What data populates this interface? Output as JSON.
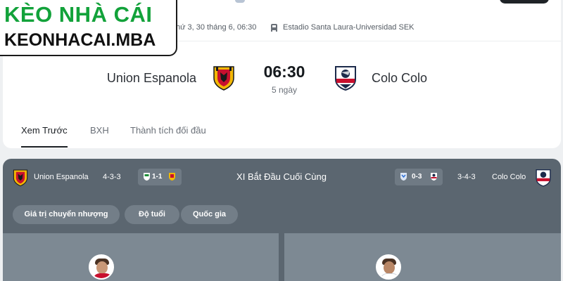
{
  "logo": {
    "line1": "KÈO NHÀ CÁI",
    "line2": "KEONHACAI.MBA"
  },
  "match": {
    "date_text": "hứ 3, 30 tháng 6, 06:30",
    "venue": "Estadio Santa Laura-Universidad SEK",
    "home_team": "Union Espanola",
    "away_team": "Colo Colo",
    "kickoff": "06:30",
    "countdown": "5 ngày"
  },
  "tabs": [
    {
      "label": "Xem Trước",
      "active": true
    },
    {
      "label": "BXH",
      "active": false
    },
    {
      "label": "Thành tích đối đầu",
      "active": false
    }
  ],
  "lineup": {
    "title": "XI Bắt Đầu Cuối Cùng",
    "home_team": "Union Espanola",
    "home_formation": "4-3-3",
    "home_last_score": "1-1",
    "away_team": "Colo Colo",
    "away_formation": "3-4-3",
    "away_last_score": "0-3"
  },
  "filters": [
    "Giá trị chuyển nhượng",
    "Độ tuổi",
    "Quốc gia"
  ],
  "icons": [
    "ball-icon",
    "stadium-icon",
    "union-espanola-crest-icon",
    "colo-colo-crest-icon",
    "player-avatar-icon"
  ],
  "colors": {
    "brand_green": "#12a23a",
    "panel": "#5b6670",
    "home_red": "#c8102e",
    "home_gold": "#f2b705",
    "away_navy": "#1b2a4a"
  }
}
